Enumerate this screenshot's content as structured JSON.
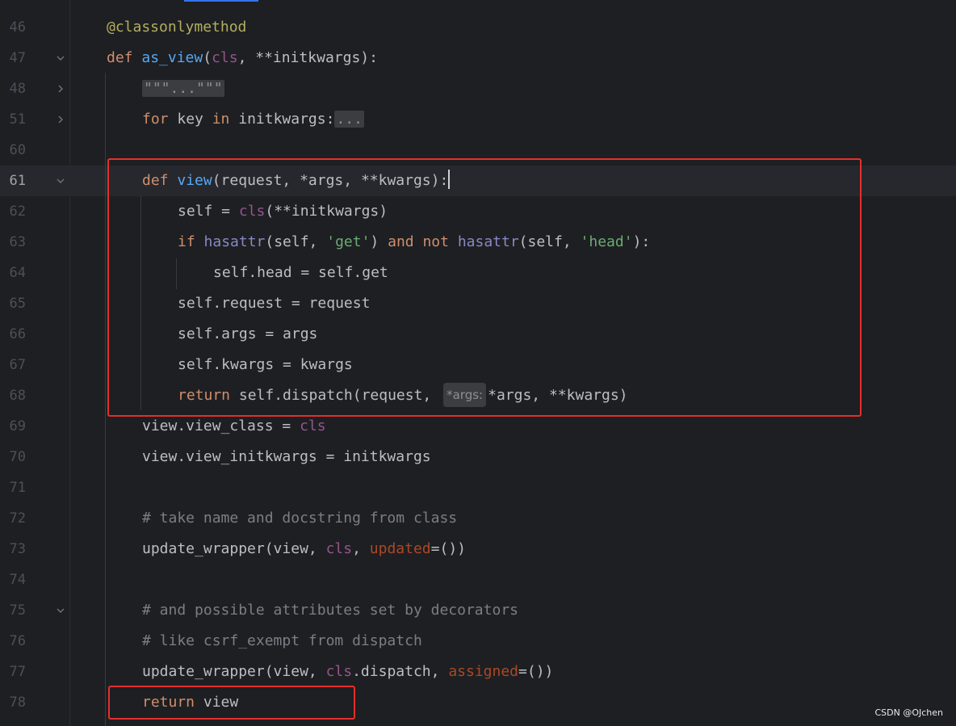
{
  "watermark": "CSDN @OJchen",
  "colors": {
    "background": "#1e1f22",
    "keyword": "#cf8e6d",
    "function": "#56a8f5",
    "self_param": "#94558d",
    "builtin": "#8888c6",
    "string": "#6aab73",
    "comment": "#7a7e85",
    "decorator": "#b3ae60",
    "named_arg": "#aa4926",
    "highlight_box": "#e3302c"
  },
  "lines": [
    {
      "num": "46",
      "fold": "",
      "tokens": [
        {
          "t": "@classonlymethod",
          "c": "dec"
        }
      ]
    },
    {
      "num": "47",
      "fold": "chevron-down",
      "tokens": [
        {
          "t": "def ",
          "c": "kw"
        },
        {
          "t": "as_view",
          "c": "fn"
        },
        {
          "t": "(",
          "c": "plain"
        },
        {
          "t": "cls",
          "c": "self"
        },
        {
          "t": ", **initkwargs):",
          "c": "plain"
        }
      ]
    },
    {
      "num": "48",
      "fold": "chevron-right",
      "tokens": [
        {
          "t": "\"\"\"...\"\"\"",
          "c": "folded"
        }
      ]
    },
    {
      "num": "51",
      "fold": "chevron-right",
      "tokens": [
        {
          "t": "for ",
          "c": "kw"
        },
        {
          "t": "key ",
          "c": "plain"
        },
        {
          "t": "in ",
          "c": "kw"
        },
        {
          "t": "initkwargs:",
          "c": "plain"
        },
        {
          "t": "...",
          "c": "folded"
        }
      ]
    },
    {
      "num": "60",
      "fold": "",
      "tokens": []
    },
    {
      "num": "61",
      "fold": "chevron-down",
      "current": true,
      "tokens": [
        {
          "t": "def ",
          "c": "kw"
        },
        {
          "t": "view",
          "c": "fn"
        },
        {
          "t": "(request, *args, **kwargs):",
          "c": "plain"
        },
        {
          "t": "",
          "c": "caret"
        }
      ]
    },
    {
      "num": "62",
      "fold": "",
      "tokens": [
        {
          "t": "self = ",
          "c": "plain"
        },
        {
          "t": "cls",
          "c": "self"
        },
        {
          "t": "(**initkwargs)",
          "c": "plain"
        }
      ]
    },
    {
      "num": "63",
      "fold": "",
      "tokens": [
        {
          "t": "if ",
          "c": "kw"
        },
        {
          "t": "hasattr",
          "c": "bi"
        },
        {
          "t": "(self, ",
          "c": "plain"
        },
        {
          "t": "'get'",
          "c": "str"
        },
        {
          "t": ") ",
          "c": "plain"
        },
        {
          "t": "and not ",
          "c": "kw"
        },
        {
          "t": "hasattr",
          "c": "bi"
        },
        {
          "t": "(self, ",
          "c": "plain"
        },
        {
          "t": "'head'",
          "c": "str"
        },
        {
          "t": "):",
          "c": "plain"
        }
      ]
    },
    {
      "num": "64",
      "fold": "",
      "tokens": [
        {
          "t": "self.head = self.get",
          "c": "plain"
        }
      ]
    },
    {
      "num": "65",
      "fold": "",
      "tokens": [
        {
          "t": "self.request = request",
          "c": "plain"
        }
      ]
    },
    {
      "num": "66",
      "fold": "",
      "tokens": [
        {
          "t": "self.args = args",
          "c": "plain"
        }
      ]
    },
    {
      "num": "67",
      "fold": "",
      "tokens": [
        {
          "t": "self.kwargs = kwargs",
          "c": "plain"
        }
      ]
    },
    {
      "num": "68",
      "fold": "",
      "tokens": [
        {
          "t": "return ",
          "c": "kw"
        },
        {
          "t": "self.dispatch(request, ",
          "c": "plain"
        },
        {
          "t": "*args:",
          "c": "hint"
        },
        {
          "t": "*args, **kwargs)",
          "c": "plain"
        }
      ]
    },
    {
      "num": "69",
      "fold": "",
      "tokens": [
        {
          "t": "view.view_class = ",
          "c": "plain"
        },
        {
          "t": "cls",
          "c": "self"
        }
      ]
    },
    {
      "num": "70",
      "fold": "",
      "tokens": [
        {
          "t": "view.view_initkwargs = initkwargs",
          "c": "plain"
        }
      ]
    },
    {
      "num": "71",
      "fold": "",
      "tokens": []
    },
    {
      "num": "72",
      "fold": "",
      "tokens": [
        {
          "t": "# take name and docstring from class",
          "c": "cmt"
        }
      ]
    },
    {
      "num": "73",
      "fold": "",
      "tokens": [
        {
          "t": "update_wrapper(view, ",
          "c": "plain"
        },
        {
          "t": "cls",
          "c": "self"
        },
        {
          "t": ", ",
          "c": "plain"
        },
        {
          "t": "updated",
          "c": "named"
        },
        {
          "t": "=())",
          "c": "plain"
        }
      ]
    },
    {
      "num": "74",
      "fold": "",
      "tokens": []
    },
    {
      "num": "75",
      "fold": "chevron-down",
      "tokens": [
        {
          "t": "# and possible attributes set by decorators",
          "c": "cmt"
        }
      ]
    },
    {
      "num": "76",
      "fold": "",
      "tokens": [
        {
          "t": "# like csrf_exempt from dispatch",
          "c": "cmt"
        }
      ]
    },
    {
      "num": "77",
      "fold": "",
      "tokens": [
        {
          "t": "update_wrapper(view, ",
          "c": "plain"
        },
        {
          "t": "cls",
          "c": "self"
        },
        {
          "t": ".dispatch, ",
          "c": "plain"
        },
        {
          "t": "assigned",
          "c": "named"
        },
        {
          "t": "=())",
          "c": "plain"
        }
      ]
    },
    {
      "num": "78",
      "fold": "",
      "tokens": [
        {
          "t": "return ",
          "c": "kw"
        },
        {
          "t": "view",
          "c": "plain"
        }
      ]
    }
  ]
}
